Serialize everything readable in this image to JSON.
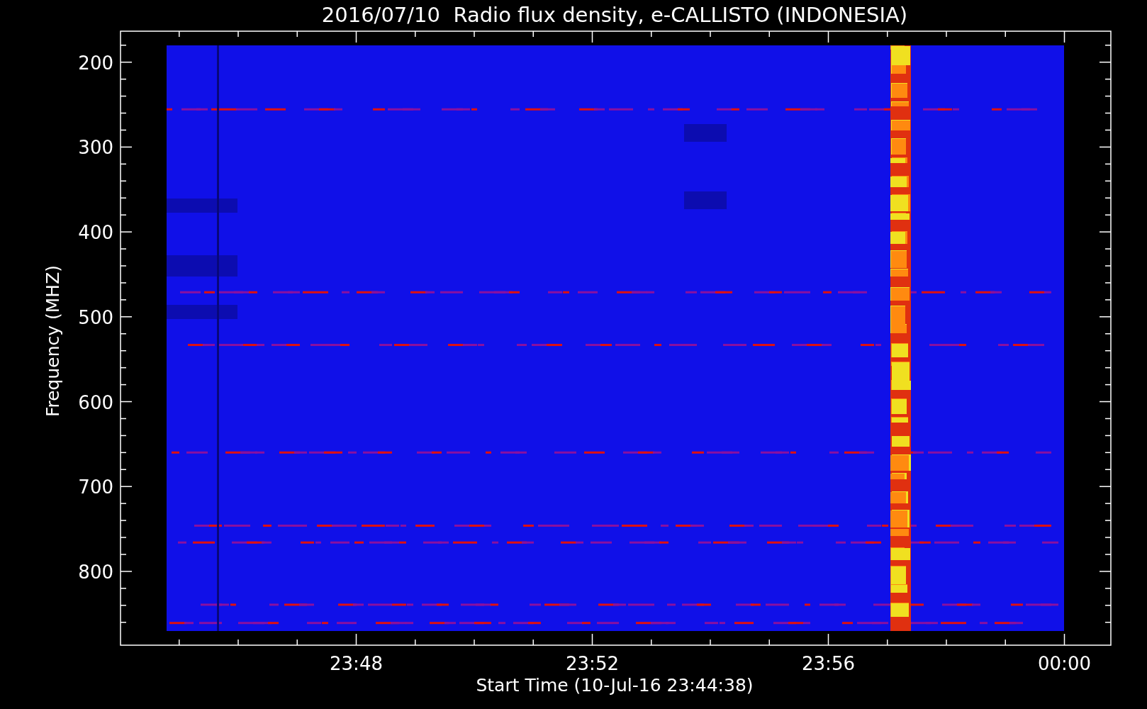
{
  "title": "2016/07/10  Radio flux density, e-CALLISTO (INDONESIA)",
  "y_axis": {
    "label": "Frequency (MHZ)",
    "ticks": [
      "200",
      "300",
      "400",
      "500",
      "600",
      "700",
      "800"
    ]
  },
  "x_axis": {
    "label": "Start Time (10-Jul-16 23:44:38)",
    "ticks": [
      "23:48",
      "23:52",
      "23:56",
      "00:00"
    ]
  }
}
